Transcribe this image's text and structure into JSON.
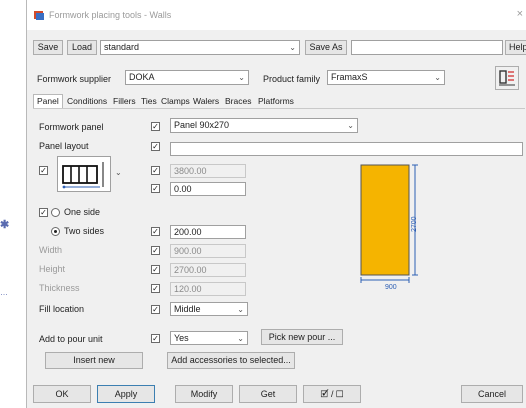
{
  "window": {
    "title": "Formwork placing tools - Walls",
    "close_glyph": "×",
    "icon": "app-icon"
  },
  "edge_marks": [
    "✱",
    "…"
  ],
  "toolbar": {
    "save_label": "Save",
    "load_label": "Load",
    "preset_value": "standard",
    "save_as_label": "Save As",
    "save_as_value": "",
    "help_label": "Help"
  },
  "supplier": {
    "label": "Formwork supplier",
    "value": "DOKA",
    "family_label": "Product family",
    "family_value": "FramaxS",
    "icon": "formwork-tool-icon"
  },
  "tabs": [
    "Panel",
    "Conditions",
    "Fillers",
    "Ties",
    "Clamps",
    "Walers",
    "Braces",
    "Platforms"
  ],
  "active_tab": "Panel",
  "panel": {
    "formwork_panel_label": "Formwork panel",
    "formwork_panel_value": "Panel 90x270",
    "panel_layout_label": "Panel layout",
    "panel_layout_value": "",
    "value_3800": "3800.00",
    "value_000": "0.00",
    "one_side_label": "One side",
    "two_sides_label": "Two sides",
    "two_sides_value": "200.00",
    "width_label": "Width",
    "width_value": "900.00",
    "height_label": "Height",
    "height_value": "2700.00",
    "thickness_label": "Thickness",
    "thickness_value": "120.00",
    "fill_location_label": "Fill location",
    "fill_location_value": "Middle",
    "add_to_pour_label": "Add to pour unit",
    "add_to_pour_value": "Yes",
    "pick_new_pour_label": "Pick new pour ...",
    "insert_new_label": "Insert new",
    "add_accessories_label": "Add accessories to selected..."
  },
  "preview": {
    "height_dim": "2700",
    "width_dim": "900",
    "fill_color": "#f5b400"
  },
  "bottom": {
    "ok_label": "OK",
    "apply_label": "Apply",
    "modify_label": "Modify",
    "get_label": "Get",
    "toggle_label": "🗹 / ☐",
    "cancel_label": "Cancel"
  },
  "colors": {
    "dialog_bg": "#f0f0f0",
    "accent_border": "#3c7fb1",
    "panel_yellow": "#f5b400",
    "dimension_blue": "#2d5fb4"
  }
}
